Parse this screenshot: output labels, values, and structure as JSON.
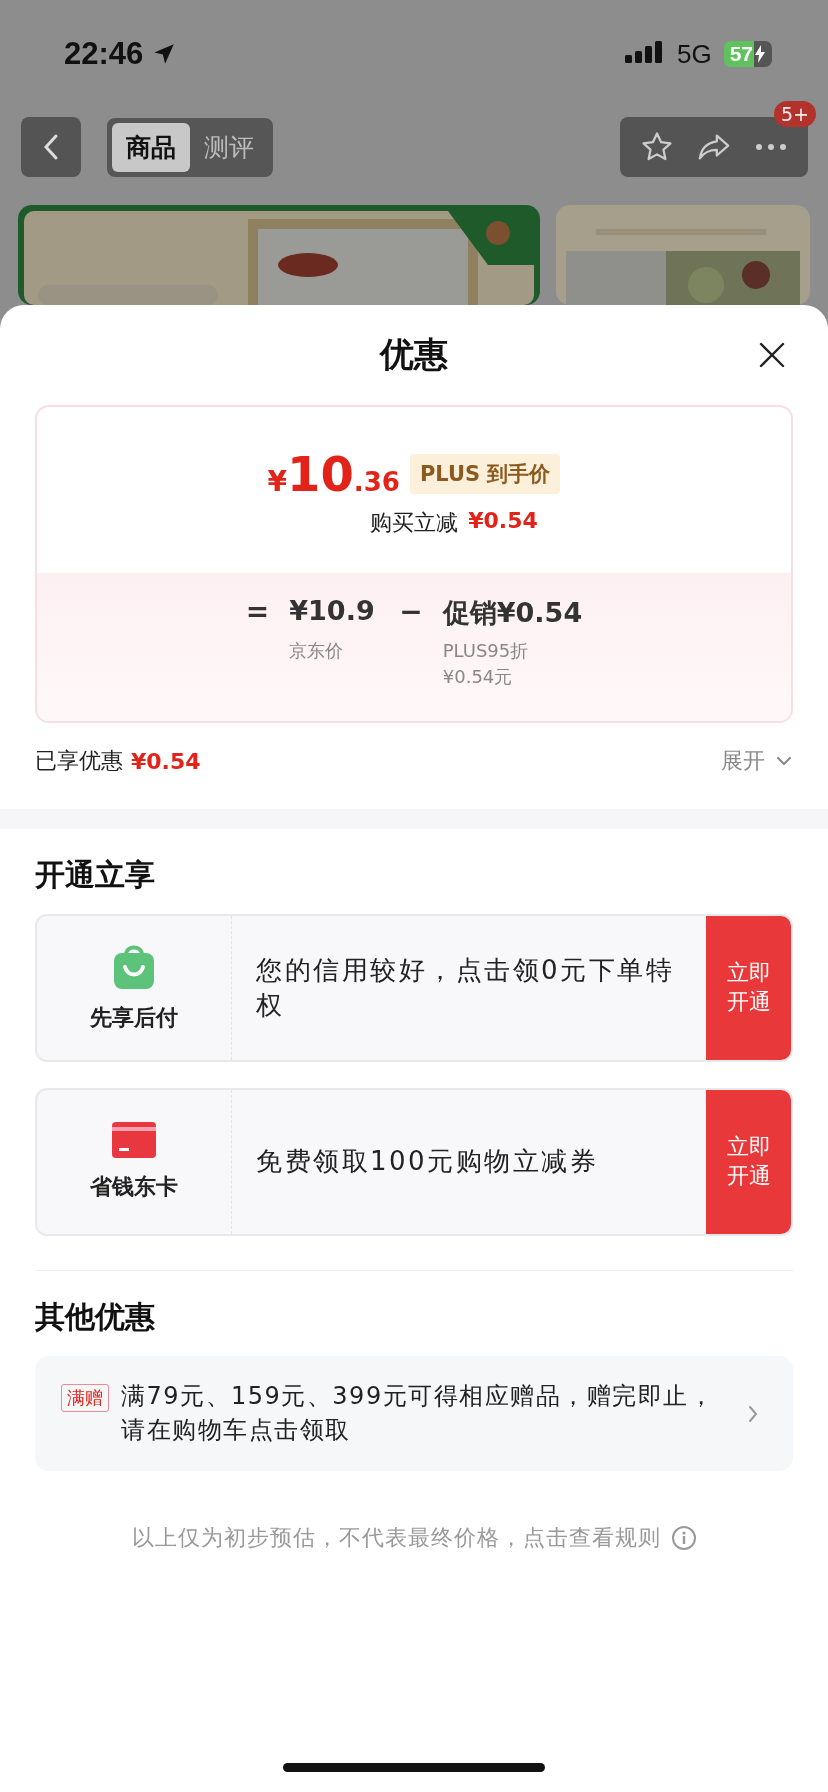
{
  "status_bar": {
    "time": "22:46",
    "network": "5G",
    "battery": "57"
  },
  "nav": {
    "tabs": [
      {
        "label": "商品",
        "selected": true
      },
      {
        "label": "测评",
        "selected": false
      }
    ],
    "badge": "5+"
  },
  "sheet": {
    "title": "优惠",
    "price": {
      "symbol": "¥",
      "integer": "10",
      "decimal": ".36",
      "tag": "PLUS 到手价",
      "reduce_label": "购买立减",
      "reduce_value": "¥0.54"
    },
    "formula": {
      "equals": "=",
      "base": "¥10.9",
      "base_label": "京东价",
      "minus": "−",
      "promo": "促销¥0.54",
      "promo_detail": [
        "PLUS95折",
        "¥0.54元"
      ]
    },
    "enjoyed": {
      "label": "已享优惠",
      "value": "¥0.54",
      "expand": "展开"
    },
    "open_section": {
      "title": "开通立享",
      "items": [
        {
          "kind": "bag",
          "name": "先享后付",
          "description": "您的信用较好，点击领0元下单特权",
          "button": "立即开通"
        },
        {
          "kind": "card",
          "name": "省钱东卡",
          "description": "免费领取100元购物立减券",
          "button": "立即开通"
        }
      ]
    },
    "other_section": {
      "title": "其他优惠",
      "items": [
        {
          "tag": "满赠",
          "text": "满79元、159元、399元可得相应赠品，赠完即止，请在购物车点击领取"
        }
      ]
    },
    "footer": "以上仅为初步预估，不代表最终价格，点击查看规则"
  }
}
